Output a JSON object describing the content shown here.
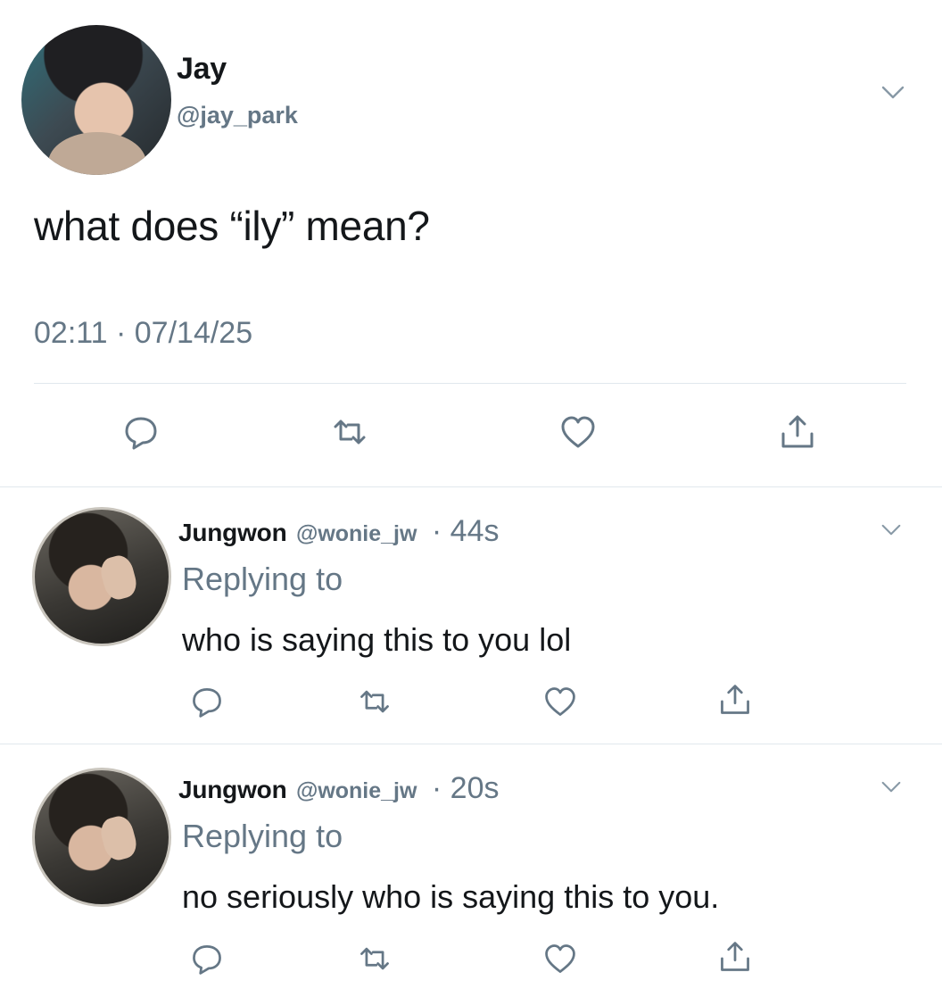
{
  "main_tweet": {
    "name": "Jay",
    "handle": "@jay_park",
    "text": "what does “ily” mean?",
    "timestamp": "02:11 · 07/14/25",
    "icons": {
      "menu": "chevron-down-icon",
      "reply": "reply-icon",
      "retweet": "retweet-icon",
      "like": "like-icon",
      "share": "share-icon"
    }
  },
  "replies": [
    {
      "name": "Jungwon",
      "handle": "@wonie_jw",
      "time": "· 44s",
      "replying_label": "Replying to",
      "text": "who is saying this to you lol"
    },
    {
      "name": "Jungwon",
      "handle": "@wonie_jw",
      "time": "· 20s",
      "replying_label": "Replying to",
      "text": "no seriously who is saying this to you."
    }
  ],
  "colors": {
    "text": "#14171a",
    "secondary": "#657786",
    "divider": "#e1e8ed"
  }
}
